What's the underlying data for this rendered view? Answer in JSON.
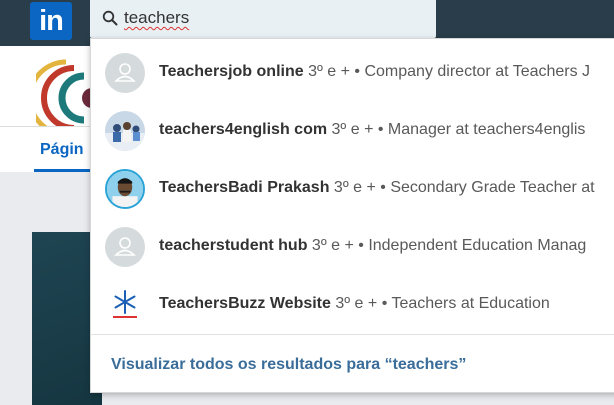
{
  "nav": {
    "logo_text": "in",
    "search_query": "teachers"
  },
  "background": {
    "active_tab": "Págin"
  },
  "results": [
    {
      "name": "Teachersjob online",
      "degree": "3º e +",
      "separator": "•",
      "headline": "Company director at Teachers J",
      "avatar": "placeholder"
    },
    {
      "name": "teachers4english com",
      "degree": "3º e +",
      "separator": "•",
      "headline": "Manager at teachers4englis",
      "avatar": "photo-group"
    },
    {
      "name": "TeachersBadi Prakash",
      "degree": "3º e +",
      "separator": "•",
      "headline": "Secondary Grade Teacher at",
      "avatar": "photo-person"
    },
    {
      "name": "teacherstudent hub",
      "degree": "3º e +",
      "separator": "•",
      "headline": "Independent Education Manag",
      "avatar": "placeholder"
    },
    {
      "name": "TeachersBuzz Website",
      "degree": "3º e +",
      "separator": "•",
      "headline": "Teachers at Education",
      "avatar": "logo-snowflake"
    }
  ],
  "see_all": {
    "label": "Visualizar todos os resultados para “teachers”"
  },
  "colors": {
    "nav_bg": "#293e4a",
    "brand": "#0a66c2",
    "link": "#3a6d99"
  }
}
